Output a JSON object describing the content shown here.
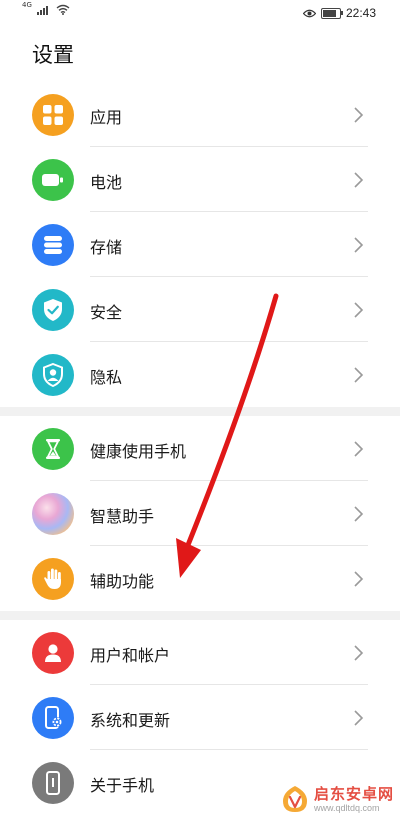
{
  "status_bar": {
    "network_type": "4G",
    "time": "22:43"
  },
  "page": {
    "title": "设置"
  },
  "settings": {
    "groups": [
      {
        "items": [
          {
            "label": "应用",
            "icon": "apps-grid-icon",
            "color": "#F5A020"
          },
          {
            "label": "电池",
            "icon": "battery-icon",
            "color": "#3CC34A"
          },
          {
            "label": "存储",
            "icon": "storage-icon",
            "color": "#2E7CF6"
          },
          {
            "label": "安全",
            "icon": "shield-check-icon",
            "color": "#22B8C8"
          },
          {
            "label": "隐私",
            "icon": "privacy-person-icon",
            "color": "#22B8C8"
          }
        ]
      },
      {
        "items": [
          {
            "label": "健康使用手机",
            "icon": "hourglass-icon",
            "color": "#3CC34A"
          },
          {
            "label": "智慧助手",
            "icon": "smart-assistant-orb-icon",
            "color": "#C9A6F0"
          },
          {
            "label": "辅助功能",
            "icon": "hand-icon",
            "color": "#F5A020"
          }
        ]
      },
      {
        "items": [
          {
            "label": "用户和帐户",
            "icon": "user-icon",
            "color": "#EC3A3A"
          },
          {
            "label": "系统和更新",
            "icon": "phone-settings-icon",
            "color": "#2E7CF6"
          },
          {
            "label": "关于手机",
            "icon": "phone-info-icon",
            "color": "#7A7A7A"
          }
        ]
      }
    ]
  },
  "annotation": {
    "arrow_color": "#E01818"
  },
  "watermark": {
    "brand": "启东安卓网",
    "url": "www.qdltdq.com"
  }
}
